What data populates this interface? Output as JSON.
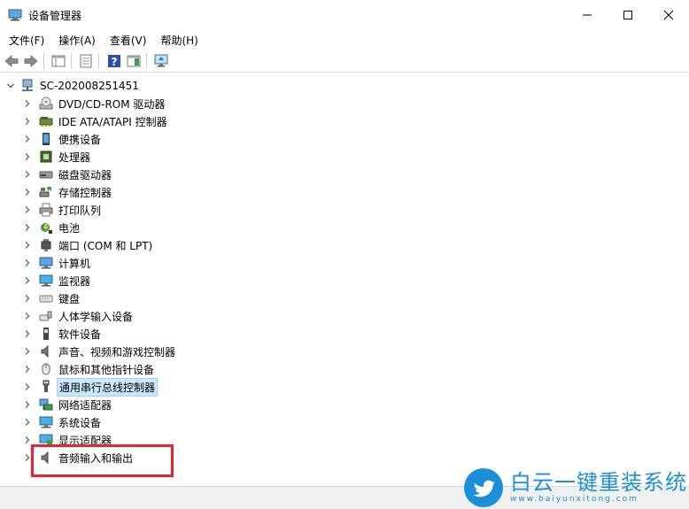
{
  "window": {
    "title": "设备管理器"
  },
  "menu": {
    "items": [
      "文件(F)",
      "操作(A)",
      "查看(V)",
      "帮助(H)"
    ]
  },
  "tree": {
    "root": "SC-202008251451",
    "items": [
      {
        "label": "DVD/CD-ROM 驱动器",
        "icon": "dvd-drive-icon"
      },
      {
        "label": "IDE ATA/ATAPI 控制器",
        "icon": "ide-controller-icon"
      },
      {
        "label": "便携设备",
        "icon": "portable-device-icon"
      },
      {
        "label": "处理器",
        "icon": "processor-icon"
      },
      {
        "label": "磁盘驱动器",
        "icon": "disk-drive-icon"
      },
      {
        "label": "存储控制器",
        "icon": "storage-controller-icon"
      },
      {
        "label": "打印队列",
        "icon": "printer-icon"
      },
      {
        "label": "电池",
        "icon": "battery-icon"
      },
      {
        "label": "端口 (COM 和 LPT)",
        "icon": "port-icon"
      },
      {
        "label": "计算机",
        "icon": "computer-icon"
      },
      {
        "label": "监视器",
        "icon": "monitor-icon"
      },
      {
        "label": "键盘",
        "icon": "keyboard-icon"
      },
      {
        "label": "人体学输入设备",
        "icon": "hid-icon"
      },
      {
        "label": "软件设备",
        "icon": "software-device-icon"
      },
      {
        "label": "声音、视频和游戏控制器",
        "icon": "sound-icon"
      },
      {
        "label": "鼠标和其他指针设备",
        "icon": "mouse-icon"
      },
      {
        "label": "通用串行总线控制器",
        "icon": "usb-icon"
      },
      {
        "label": "网络适配器",
        "icon": "network-adapter-icon"
      },
      {
        "label": "系统设备",
        "icon": "system-device-icon"
      },
      {
        "label": "显示适配器",
        "icon": "display-adapter-icon"
      },
      {
        "label": "音频输入和输出",
        "icon": "audio-io-icon"
      }
    ]
  },
  "watermark": {
    "main": "白云一键重装系统",
    "url": "www.baiyunxitong.com"
  },
  "colors": {
    "highlight": "#e8242f",
    "selection": "#cce8ff",
    "brand": "#1d8fd8"
  }
}
